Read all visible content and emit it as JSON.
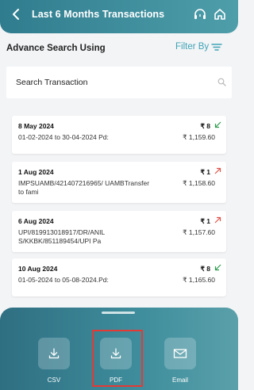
{
  "header": {
    "title": "Last 6 Months Transactions"
  },
  "search": {
    "heading": "Advance Search Using",
    "filter_label": "Filter By",
    "placeholder": "Search Transaction"
  },
  "transactions": [
    {
      "date": "8 May 2024",
      "count": "₹ 8",
      "direction": "credit",
      "desc": "01-02-2024 to 30-04-2024 Pd:",
      "amount": "₹ 1,159.60"
    },
    {
      "date": "1 Aug 2024",
      "count": "₹ 1",
      "direction": "debit",
      "desc": "IMPSUAMB/421407216965/ UAMBTransfer to fami",
      "amount": "₹ 1,158.60"
    },
    {
      "date": "6 Aug 2024",
      "count": "₹ 1",
      "direction": "debit",
      "desc": "UPI/819913018917/DR/ANIL S/KKBK/851189454/UPI Pa",
      "amount": "₹ 1,157.60"
    },
    {
      "date": "10 Aug 2024",
      "count": "₹ 8",
      "direction": "credit",
      "desc": "01-05-2024 to 05-08-2024.Pd:",
      "amount": "₹ 1,165.60"
    }
  ],
  "download": {
    "csv_label": "CSV",
    "pdf_label": "PDF",
    "email_label": "Email"
  },
  "colors": {
    "credit_arrow": "#2e9d4f",
    "debit_arrow": "#e0524a",
    "accent": "#3ea3b5",
    "highlight": "#e53935"
  }
}
